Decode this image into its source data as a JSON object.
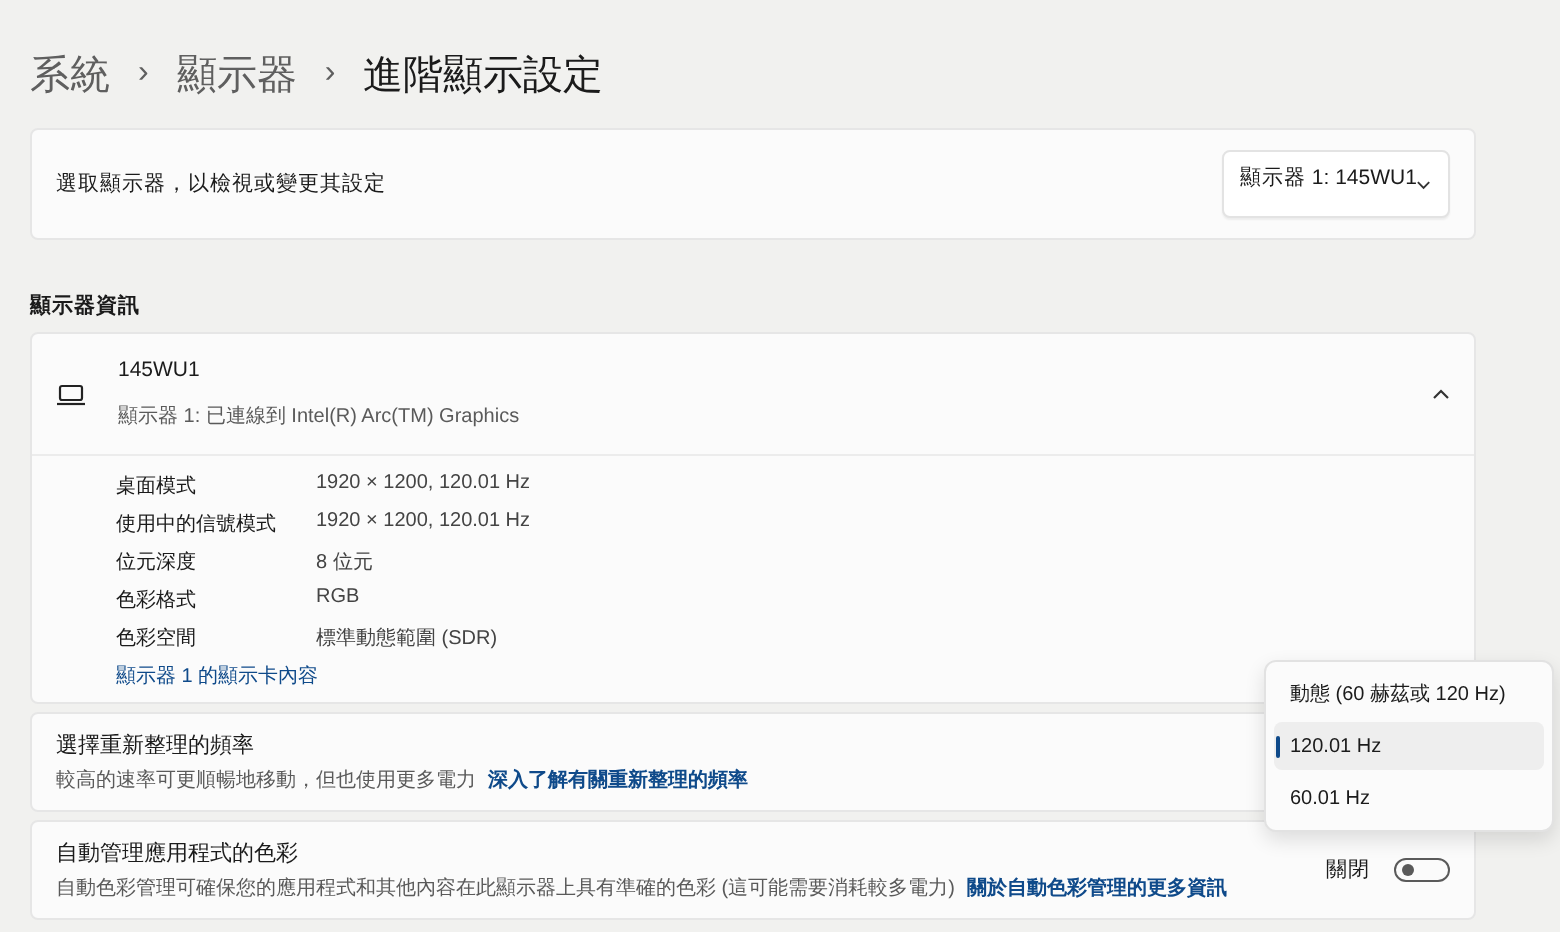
{
  "breadcrumb": [
    {
      "label": "系統",
      "current": false
    },
    {
      "label": "顯示器",
      "current": false
    },
    {
      "label": "進階顯示設定",
      "current": true
    }
  ],
  "breadcrumb_separator": "›",
  "display_select": {
    "label": "選取顯示器，以檢視或變更其設定",
    "value": "顯示器 1: 145WU1"
  },
  "section_title": "顯示器資訊",
  "display_info": {
    "name": "145WU1",
    "subtitle": "顯示器 1: 已連線到 Intel(R) Arc(TM) Graphics",
    "expanded": true,
    "rows": [
      {
        "label": "桌面模式",
        "value": "1920 × 1200, 120.01 Hz"
      },
      {
        "label": "使用中的信號模式",
        "value": "1920 × 1200, 120.01 Hz"
      },
      {
        "label": "位元深度",
        "value": "8 位元"
      },
      {
        "label": "色彩格式",
        "value": "RGB"
      },
      {
        "label": "色彩空間",
        "value": "標準動態範圍 (SDR)"
      }
    ],
    "link": "顯示器 1 的顯示卡內容"
  },
  "refresh_rate": {
    "title": "選擇重新整理的頻率",
    "description": "較高的速率可更順暢地移動，但也使用更多電力",
    "link": "深入了解有關重新整理的頻率",
    "options": [
      {
        "label": "動態 (60 赫茲或 120 Hz)",
        "selected": false
      },
      {
        "label": "120.01 Hz",
        "selected": true
      },
      {
        "label": "60.01 Hz",
        "selected": false
      }
    ]
  },
  "auto_color": {
    "title": "自動管理應用程式的色彩",
    "description": "自動色彩管理可確保您的應用程式和其他內容在此顯示器上具有準確的色彩 (這可能需要消耗較多電力)",
    "link": "關於自動色彩管理的更多資訊",
    "state_label": "關閉",
    "on": false
  }
}
